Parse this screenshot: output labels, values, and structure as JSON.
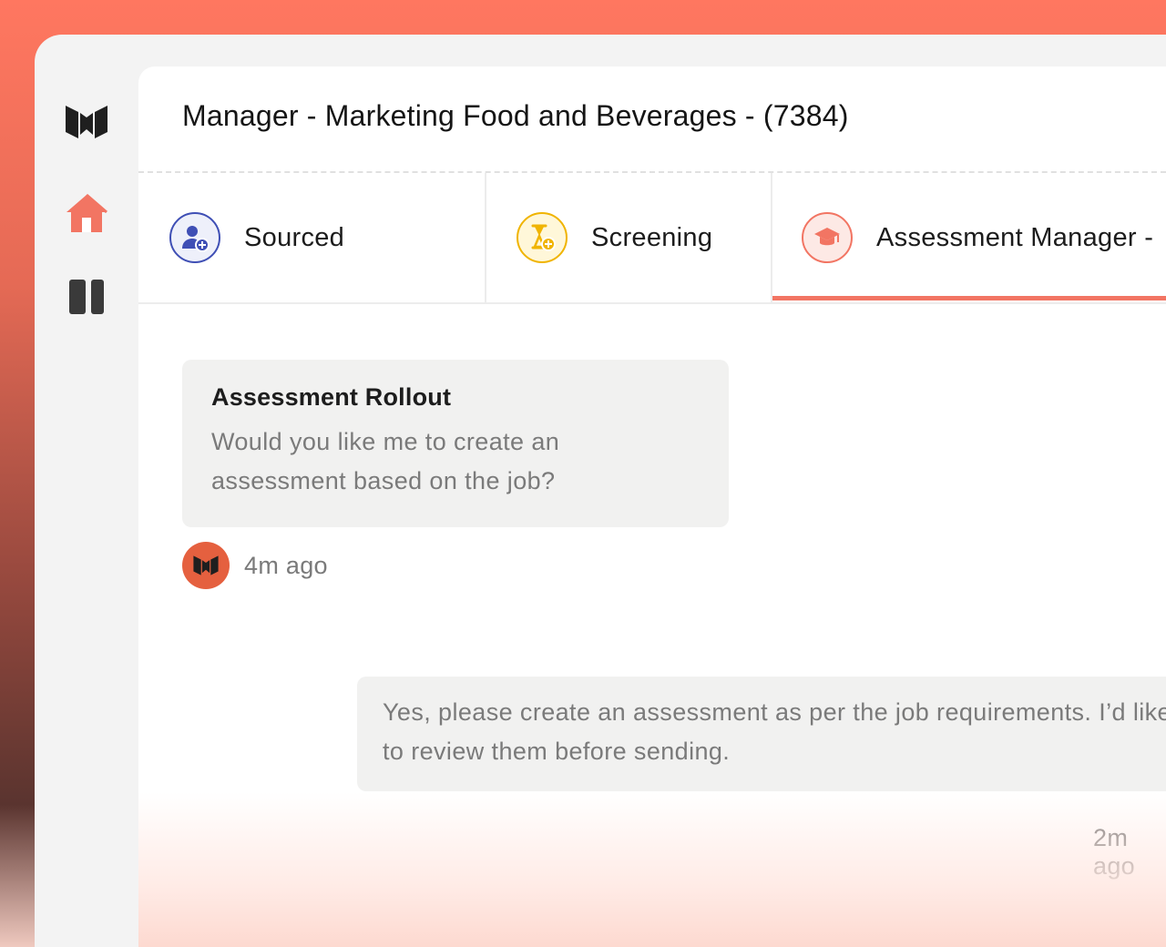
{
  "app": {
    "nav": [
      {
        "icon": "logo-icon"
      },
      {
        "icon": "home-icon",
        "active": true
      },
      {
        "icon": "sidebar-toggle-icon"
      }
    ]
  },
  "header": {
    "title": "Manager - Marketing Food and Beverages - (7384)"
  },
  "tabs": [
    {
      "label": "Sourced",
      "icon": "user-plus-icon",
      "color": "#3f4fb5",
      "fill": "#e8eaf7"
    },
    {
      "label": "Screening",
      "icon": "hourglass-plus-icon",
      "color": "#f0b400",
      "fill": "#fff6d6"
    },
    {
      "label": "Assessment Manager -",
      "icon": "graduation-cap-icon",
      "color": "#f27563",
      "fill": "#fde8e4",
      "active": true
    }
  ],
  "chat": {
    "messages": [
      {
        "title": "Assessment Rollout",
        "text": "Would you like me to create an assessment based on the job?",
        "time": "4m ago",
        "sender": "assistant"
      },
      {
        "text": "Yes, please create an assessment as per the job requirements. I’d like to review them before sending.",
        "time": "2m ago",
        "sender": "user"
      }
    ]
  },
  "colors": {
    "accent": "#f27563",
    "avatar": "#e5603f"
  }
}
